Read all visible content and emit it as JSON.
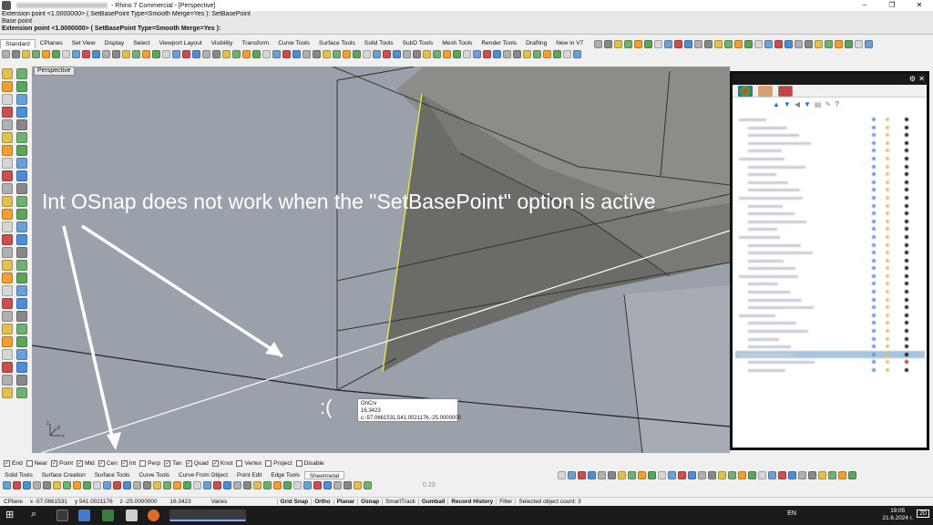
{
  "window": {
    "title": "- Rhino 7 Commercial - [Perspective]",
    "controls": [
      "–",
      "❐",
      "✕"
    ]
  },
  "command_history": {
    "line1": "Extension point <1.0000000> ( SetBasePoint  Type=Smooth  Merge=Yes ): SetBasePoint",
    "line2": "Base point",
    "prompt": "Extension point <1.0000000> ( SetBasePoint  Type=Smooth  Merge=Yes ):"
  },
  "toolbar_tabs": [
    "Standard",
    "CPlanes",
    "Set View",
    "Display",
    "Select",
    "Viewport Layout",
    "Visibility",
    "Transform",
    "Curve Tools",
    "Surface Tools",
    "Solid Tools",
    "SubD Tools",
    "Mesh Tools",
    "Render Tools",
    "Drafting",
    "New in V7"
  ],
  "viewport": {
    "title": "Perspective",
    "annotation": "Int OSnap does not work when the \"SetBasePoint\" option is active",
    "sad_face": ":(",
    "axis_x": "x",
    "axis_y": "y",
    "axis_z": "z",
    "tooltip": {
      "line1": "OnCrv",
      "line2": "16.3423",
      "line3": "c:-57.0661531,541.0021176,-25.0000000"
    },
    "colors": {
      "background": "#9ba1ab",
      "surface": "#6b6c68",
      "surface_light": "#8c8d88",
      "highlight": "#e6e24a"
    }
  },
  "layers_panel": {
    "header_icons": [
      "gear-icon",
      "close-icon"
    ],
    "rows": 33,
    "selected_row": 30
  },
  "osnap": [
    {
      "label": "End",
      "checked": true
    },
    {
      "label": "Near",
      "checked": false
    },
    {
      "label": "Point",
      "checked": true
    },
    {
      "label": "Mid",
      "checked": true
    },
    {
      "label": "Cen",
      "checked": true
    },
    {
      "label": "Int",
      "checked": true
    },
    {
      "label": "Perp",
      "checked": false
    },
    {
      "label": "Tan",
      "checked": true
    },
    {
      "label": "Quad",
      "checked": true
    },
    {
      "label": "Knot",
      "checked": true
    },
    {
      "label": "Vertex",
      "checked": false
    },
    {
      "label": "Project",
      "checked": false
    },
    {
      "label": "Disable",
      "checked": false
    }
  ],
  "bottom_tabs": [
    "Solid Tools",
    "Surface Creation",
    "Surface Tools",
    "Curve Tools",
    "Curve From Object",
    "Point Edit",
    "Edge Tools",
    "Sheetmetal"
  ],
  "bottom_value": "0.23",
  "status": {
    "cplane": "CPlane",
    "x": "x -57.0661531",
    "y": "y 541.0021176",
    "z": "z -25.0000000",
    "dist": "16.3423",
    "varies": "Varies",
    "panes": [
      {
        "label": "Grid Snap",
        "bold": true
      },
      {
        "label": "Ortho",
        "bold": true
      },
      {
        "label": "Planar",
        "bold": true
      },
      {
        "label": "Osnap",
        "bold": true
      },
      {
        "label": "SmartTrack",
        "bold": false
      },
      {
        "label": "Gumball",
        "bold": true
      },
      {
        "label": "Record History",
        "bold": true
      },
      {
        "label": "Filter",
        "bold": false
      }
    ],
    "message": "Selected object count: 3"
  },
  "taskbar": {
    "lang": "EN",
    "time": "19:05",
    "date": "21.6.2024 г.",
    "notifications": "20"
  }
}
